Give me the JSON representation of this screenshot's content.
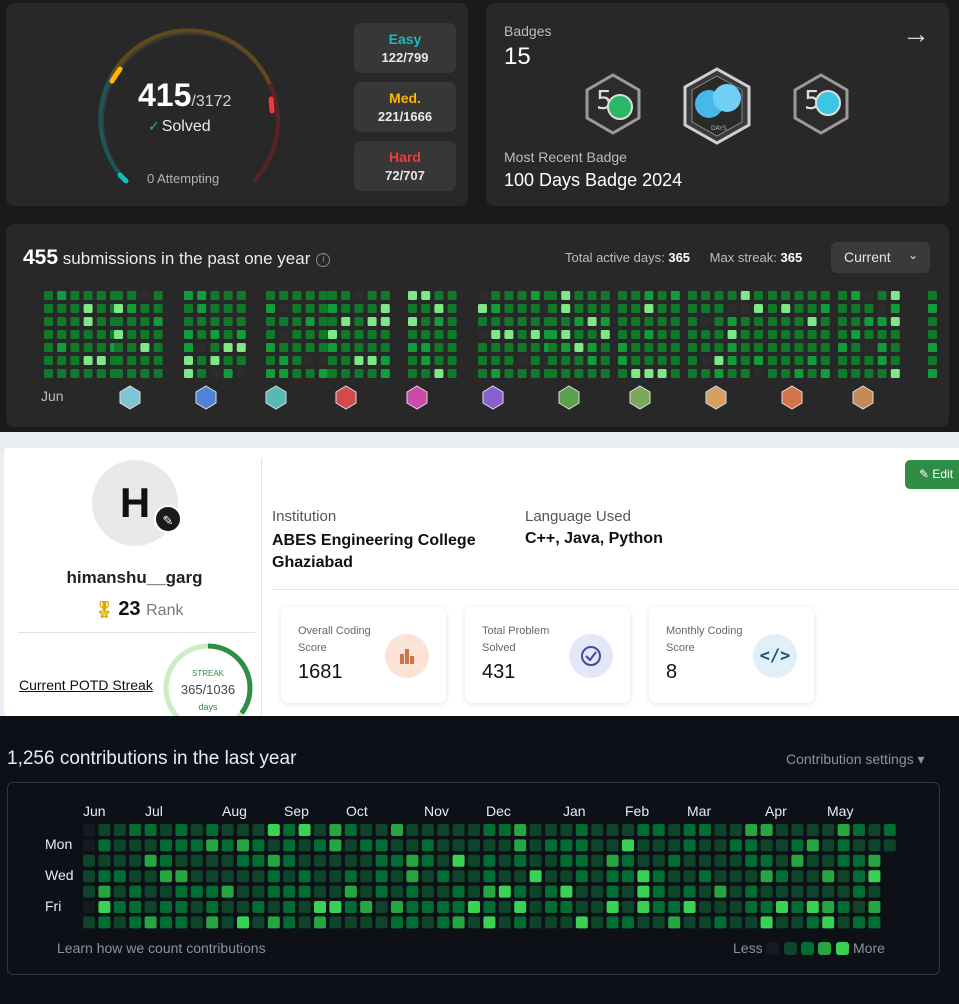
{
  "leetcode": {
    "solved": {
      "count": "415",
      "total": "/3172",
      "label": "Solved",
      "attempting": "0 Attempting",
      "difficulties": [
        {
          "label": "Easy",
          "value": "122/799",
          "color": "#1cbaba"
        },
        {
          "label": "Med.",
          "value": "221/1666",
          "color": "#ffb700"
        },
        {
          "label": "Hard",
          "value": "72/707",
          "color": "#f63737"
        }
      ]
    },
    "badges": {
      "label": "Badges",
      "count": "15",
      "recent_label": "Most Recent Badge",
      "recent_name": "100 Days Badge 2024",
      "icons": [
        "50-days-badge-icon",
        "100-days-badge-icon",
        "50-days-badge-icon"
      ]
    },
    "heatmap": {
      "submissions_count": "455",
      "submissions_text": "submissions in the past one year",
      "active_days_label": "Total active days:",
      "active_days": "365",
      "max_streak_label": "Max streak:",
      "max_streak": "365",
      "select_value": "Current",
      "month_label": "Jun",
      "badge_icons": [
        "cube-badge-icon",
        "cube-badge-icon",
        "cube-badge-icon",
        "cube-badge-icon",
        "cube-badge-icon",
        "cube-badge-icon",
        "shield-1-icon",
        "shield-2-icon",
        "shield-3-icon",
        "shield-4-icon",
        "shield-5-icon"
      ]
    }
  },
  "gfg": {
    "avatar_letter": "H",
    "username": "himanshu__garg",
    "rank": "23",
    "rank_label": "Rank",
    "potd_label": "Current POTD Streak",
    "streak": {
      "label": "STREAK",
      "value": "365/1036",
      "unit": "days",
      "fraction": 0.352
    },
    "edit_label": "Edit",
    "institution_label": "Institution",
    "institution_value": "ABES Engineering College Ghaziabad",
    "language_label": "Language Used",
    "language_value": "C++, Java, Python",
    "stats": [
      {
        "label": "Overall Coding Score",
        "value": "1681",
        "icon": "bar-chart-icon"
      },
      {
        "label": "Total Problem Solved",
        "value": "431",
        "icon": "check-circle-icon"
      },
      {
        "label": "Monthly Coding Score",
        "value": "8",
        "icon": "code-icon"
      }
    ]
  },
  "github": {
    "title": "1,256 contributions in the last year",
    "settings": "Contribution settings",
    "months": [
      "Jun",
      "Jul",
      "Aug",
      "Sep",
      "Oct",
      "Nov",
      "Dec",
      "Jan",
      "Feb",
      "Mar",
      "Apr",
      "May"
    ],
    "days": [
      "Mon",
      "Wed",
      "Fri"
    ],
    "learn": "Learn how we count contributions",
    "less": "Less",
    "more": "More",
    "legend_colors": [
      "#161b22",
      "#0e4429",
      "#006d32",
      "#26a641",
      "#39d353"
    ]
  }
}
